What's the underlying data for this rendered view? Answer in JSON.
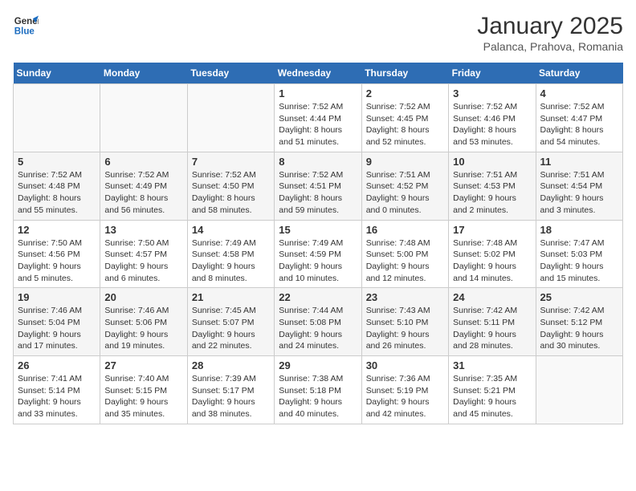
{
  "logo": {
    "line1": "General",
    "line2": "Blue"
  },
  "title": "January 2025",
  "location": "Palanca, Prahova, Romania",
  "weekdays": [
    "Sunday",
    "Monday",
    "Tuesday",
    "Wednesday",
    "Thursday",
    "Friday",
    "Saturday"
  ],
  "weeks": [
    [
      {
        "day": "",
        "text": ""
      },
      {
        "day": "",
        "text": ""
      },
      {
        "day": "",
        "text": ""
      },
      {
        "day": "1",
        "text": "Sunrise: 7:52 AM\nSunset: 4:44 PM\nDaylight: 8 hours\nand 51 minutes."
      },
      {
        "day": "2",
        "text": "Sunrise: 7:52 AM\nSunset: 4:45 PM\nDaylight: 8 hours\nand 52 minutes."
      },
      {
        "day": "3",
        "text": "Sunrise: 7:52 AM\nSunset: 4:46 PM\nDaylight: 8 hours\nand 53 minutes."
      },
      {
        "day": "4",
        "text": "Sunrise: 7:52 AM\nSunset: 4:47 PM\nDaylight: 8 hours\nand 54 minutes."
      }
    ],
    [
      {
        "day": "5",
        "text": "Sunrise: 7:52 AM\nSunset: 4:48 PM\nDaylight: 8 hours\nand 55 minutes."
      },
      {
        "day": "6",
        "text": "Sunrise: 7:52 AM\nSunset: 4:49 PM\nDaylight: 8 hours\nand 56 minutes."
      },
      {
        "day": "7",
        "text": "Sunrise: 7:52 AM\nSunset: 4:50 PM\nDaylight: 8 hours\nand 58 minutes."
      },
      {
        "day": "8",
        "text": "Sunrise: 7:52 AM\nSunset: 4:51 PM\nDaylight: 8 hours\nand 59 minutes."
      },
      {
        "day": "9",
        "text": "Sunrise: 7:51 AM\nSunset: 4:52 PM\nDaylight: 9 hours\nand 0 minutes."
      },
      {
        "day": "10",
        "text": "Sunrise: 7:51 AM\nSunset: 4:53 PM\nDaylight: 9 hours\nand 2 minutes."
      },
      {
        "day": "11",
        "text": "Sunrise: 7:51 AM\nSunset: 4:54 PM\nDaylight: 9 hours\nand 3 minutes."
      }
    ],
    [
      {
        "day": "12",
        "text": "Sunrise: 7:50 AM\nSunset: 4:56 PM\nDaylight: 9 hours\nand 5 minutes."
      },
      {
        "day": "13",
        "text": "Sunrise: 7:50 AM\nSunset: 4:57 PM\nDaylight: 9 hours\nand 6 minutes."
      },
      {
        "day": "14",
        "text": "Sunrise: 7:49 AM\nSunset: 4:58 PM\nDaylight: 9 hours\nand 8 minutes."
      },
      {
        "day": "15",
        "text": "Sunrise: 7:49 AM\nSunset: 4:59 PM\nDaylight: 9 hours\nand 10 minutes."
      },
      {
        "day": "16",
        "text": "Sunrise: 7:48 AM\nSunset: 5:00 PM\nDaylight: 9 hours\nand 12 minutes."
      },
      {
        "day": "17",
        "text": "Sunrise: 7:48 AM\nSunset: 5:02 PM\nDaylight: 9 hours\nand 14 minutes."
      },
      {
        "day": "18",
        "text": "Sunrise: 7:47 AM\nSunset: 5:03 PM\nDaylight: 9 hours\nand 15 minutes."
      }
    ],
    [
      {
        "day": "19",
        "text": "Sunrise: 7:46 AM\nSunset: 5:04 PM\nDaylight: 9 hours\nand 17 minutes."
      },
      {
        "day": "20",
        "text": "Sunrise: 7:46 AM\nSunset: 5:06 PM\nDaylight: 9 hours\nand 19 minutes."
      },
      {
        "day": "21",
        "text": "Sunrise: 7:45 AM\nSunset: 5:07 PM\nDaylight: 9 hours\nand 22 minutes."
      },
      {
        "day": "22",
        "text": "Sunrise: 7:44 AM\nSunset: 5:08 PM\nDaylight: 9 hours\nand 24 minutes."
      },
      {
        "day": "23",
        "text": "Sunrise: 7:43 AM\nSunset: 5:10 PM\nDaylight: 9 hours\nand 26 minutes."
      },
      {
        "day": "24",
        "text": "Sunrise: 7:42 AM\nSunset: 5:11 PM\nDaylight: 9 hours\nand 28 minutes."
      },
      {
        "day": "25",
        "text": "Sunrise: 7:42 AM\nSunset: 5:12 PM\nDaylight: 9 hours\nand 30 minutes."
      }
    ],
    [
      {
        "day": "26",
        "text": "Sunrise: 7:41 AM\nSunset: 5:14 PM\nDaylight: 9 hours\nand 33 minutes."
      },
      {
        "day": "27",
        "text": "Sunrise: 7:40 AM\nSunset: 5:15 PM\nDaylight: 9 hours\nand 35 minutes."
      },
      {
        "day": "28",
        "text": "Sunrise: 7:39 AM\nSunset: 5:17 PM\nDaylight: 9 hours\nand 38 minutes."
      },
      {
        "day": "29",
        "text": "Sunrise: 7:38 AM\nSunset: 5:18 PM\nDaylight: 9 hours\nand 40 minutes."
      },
      {
        "day": "30",
        "text": "Sunrise: 7:36 AM\nSunset: 5:19 PM\nDaylight: 9 hours\nand 42 minutes."
      },
      {
        "day": "31",
        "text": "Sunrise: 7:35 AM\nSunset: 5:21 PM\nDaylight: 9 hours\nand 45 minutes."
      },
      {
        "day": "",
        "text": ""
      }
    ]
  ]
}
